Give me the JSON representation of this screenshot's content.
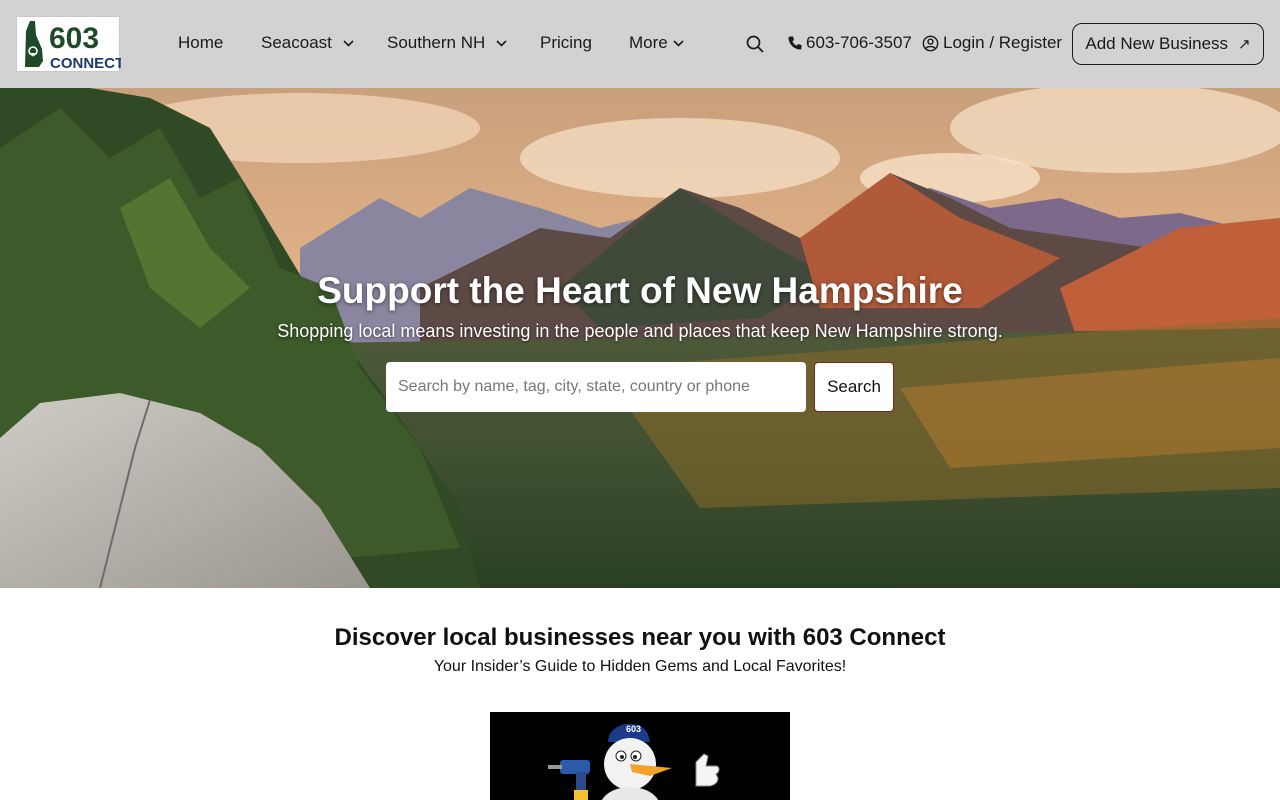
{
  "header": {
    "logo": {
      "number": "603",
      "word": "CONNECT"
    },
    "nav": [
      {
        "label": "Home",
        "icon": ""
      },
      {
        "label": "Seacoast",
        "icon": "chevron-down-icon"
      },
      {
        "label": "Southern NH",
        "icon": "chevron-down-icon"
      },
      {
        "label": "Pricing",
        "icon": ""
      },
      {
        "label": "More",
        "icon": "chevron-down-icon"
      }
    ],
    "search_icon": "search-icon",
    "phone": "603-706-3507",
    "login": "Login / Register",
    "add_business": "Add New Business"
  },
  "hero": {
    "title": "Support the Heart of New Hampshire",
    "subtitle": "Shopping local means investing in the people and places that keep New Hampshire strong.",
    "search_placeholder": "Search by name, tag, city, state, country or phone",
    "search_value": "",
    "search_button": "Search"
  },
  "discover": {
    "title": "Discover local businesses near you with 603 Connect",
    "subtitle": "Your Insider’s Guide to Hidden Gems and Local Favorites!",
    "mascot_cap_text": "603"
  },
  "colors": {
    "header_bg": "#d3d2d3",
    "logo_green": "#1f4a2a",
    "logo_blue": "#1a3a6a",
    "search_button_border": "#7a2a1a"
  }
}
